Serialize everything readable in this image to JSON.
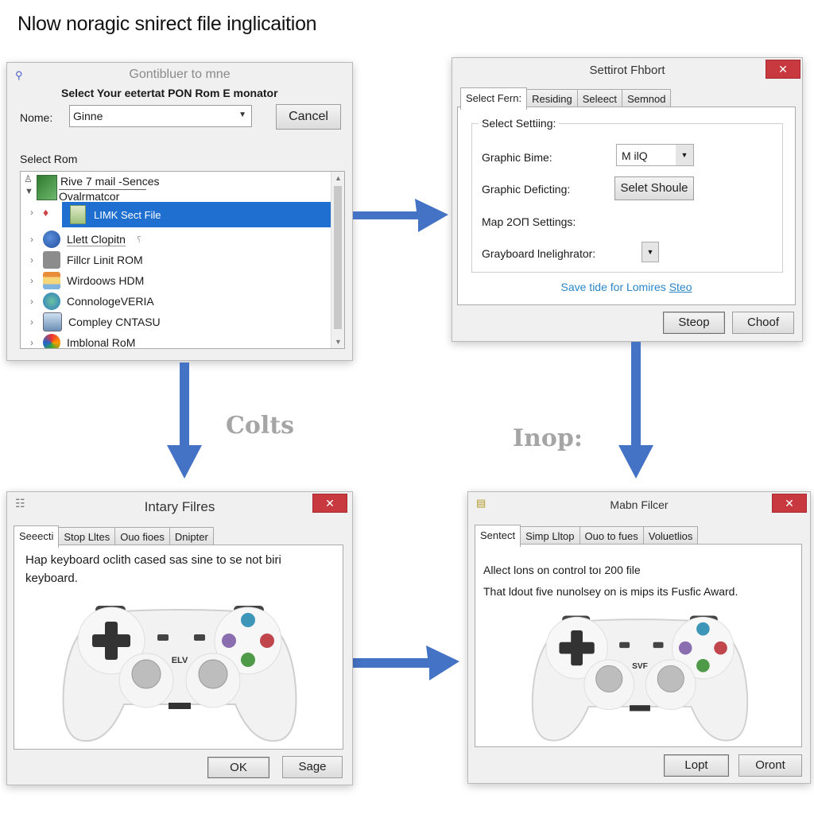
{
  "headline": "Nlow noragic snirect file inglicaition",
  "colors": {
    "arrow": "#4472c4",
    "selection": "#1e6fd0",
    "close": "#c8393f",
    "link": "#2a86c9"
  },
  "window1": {
    "title": "Gontibluer to mne",
    "subtitle": "Select Your eetertat PON Rom E monator",
    "name_label": "Nome:",
    "name_value": "Ginne",
    "cancel_label": "Cancel",
    "list_label": "Select Rom",
    "tree_header": [
      "Rive 7 mail -Sences",
      "Ovalrmatcor"
    ],
    "items": [
      {
        "label": "LIMK Sect File",
        "selected": true,
        "icon": "map-file-icon"
      },
      {
        "label": "Llett Clopitn",
        "selected": false,
        "icon": "globe-user-icon"
      },
      {
        "label": "Fillcr Linit ROM",
        "selected": false,
        "icon": "disk-icon"
      },
      {
        "label": "Wirdoows HDM",
        "selected": false,
        "icon": "window-icon"
      },
      {
        "label": "ConnologeVERIA",
        "selected": false,
        "icon": "globe-icon"
      },
      {
        "label": "Compley CNTASU",
        "selected": false,
        "icon": "picture-icon"
      },
      {
        "label": "Imblonal RoM",
        "selected": false,
        "icon": "color-wheel-icon"
      }
    ]
  },
  "window2": {
    "title": "Settirot Fhbort",
    "tabs": [
      "Select Fern:",
      "Residing",
      "Seleect",
      "Semnod"
    ],
    "group_label": "Select Settiing:",
    "rows": [
      {
        "label": "Graphic Bime:",
        "control": "dropdown",
        "value": "M ilQ"
      },
      {
        "label": "Graphic Deficting:",
        "control": "button",
        "value": "Selet Shoule"
      },
      {
        "label": "Map 2OΠ Settings:",
        "control": "none",
        "value": ""
      },
      {
        "label": "Grayboard lnelighrator:",
        "control": "dropdown",
        "value": ""
      }
    ],
    "link_text": "Save tide for Lomires",
    "link_anchor": "Steo",
    "buttons": [
      "Steop",
      "Choof"
    ]
  },
  "notes": {
    "left": "Colts",
    "right": "Inop:"
  },
  "window3": {
    "title": "Intary Filres",
    "tabs": [
      "Seeecti",
      "Stop Lltes",
      "Ouo fioes",
      "Dnipter"
    ],
    "text_line1": "Hap keyboard oclith cased sas sine to se not biri",
    "text_line2": "keyboard.",
    "controller_label": "ELV",
    "buttons": [
      "OK",
      "Sage"
    ]
  },
  "window4": {
    "title": "Mabn Filcer",
    "tabs": [
      "Sentect",
      "Simp Lltop",
      "Ouo to fues",
      "Voluetlios"
    ],
    "text_line1": "Allect lons on control toı 200 file",
    "text_line2": "That ldout five nunolsey on is mips its Fusfic Award.",
    "controller_label": "SVF",
    "buttons": [
      "Lopt",
      "Oront"
    ]
  }
}
